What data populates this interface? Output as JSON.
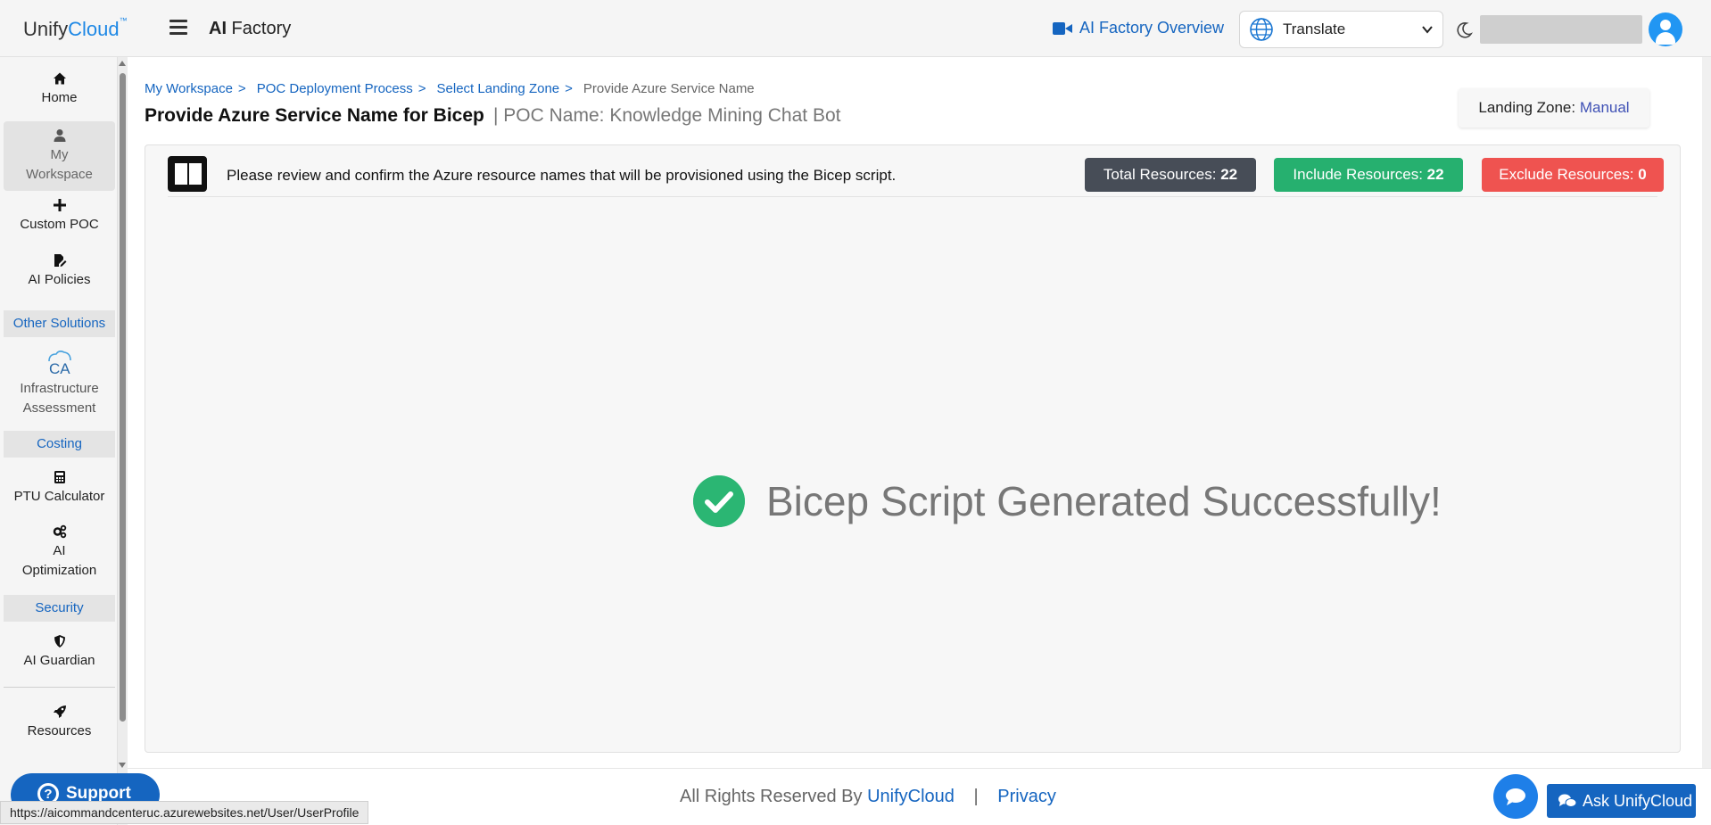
{
  "header": {
    "brand_name": "Unify",
    "brand_cloud": "Cloud",
    "brand_tm": "™",
    "app_title_bold": "AI",
    "app_title_rest": " Factory",
    "overview_link": "AI Factory Overview",
    "translate_label": "Translate"
  },
  "sidebar": {
    "items": [
      {
        "label": "Home",
        "icon": "home-icon"
      },
      {
        "label": "My Workspace",
        "icon": "user-icon"
      },
      {
        "label": "Custom POC",
        "icon": "plus-icon"
      },
      {
        "label": "AI Policies",
        "icon": "edit-document-icon"
      }
    ],
    "section_other": "Other Solutions",
    "infra_label_1": "Infrastructure",
    "infra_label_2": "Assessment",
    "section_costing": "Costing",
    "ptu_label": "PTU Calculator",
    "ai_opt_label_1": "AI",
    "ai_opt_label_2": "Optimization",
    "section_security": "Security",
    "guardian_label": "AI Guardian",
    "resources_label": "Resources",
    "my_label_1": "My",
    "my_label_2": "Workspace"
  },
  "breadcrumb": {
    "items": [
      "My Workspace",
      "POC Deployment Process",
      "Select Landing Zone"
    ],
    "separator": ">",
    "current": "Provide Azure Service Name"
  },
  "page": {
    "title": "Provide Azure Service Name for Bicep",
    "poc_name": "| POC Name: Knowledge Mining Chat Bot",
    "landing_zone_label": "Landing Zone:",
    "landing_zone_value": "Manual"
  },
  "card": {
    "notice": "Please review and confirm the Azure resource names that will be provisioned using the Bicep script.",
    "total_label": "Total Resources:",
    "total_value": "22",
    "include_label": "Include Resources:",
    "include_value": "22",
    "exclude_label": "Exclude Resources:",
    "exclude_value": "0",
    "success_message": "Bicep Script Generated Successfully!"
  },
  "footer": {
    "rights": "All Rights Reserved By",
    "company": "UnifyCloud",
    "pipe": "|",
    "privacy": "Privacy",
    "support": "Support",
    "ask": "Ask UnifyCloud",
    "status_url": "https://aicommandcenteruc.azurewebsites.net/User/UserProfile"
  },
  "colors": {
    "accent": "#1565c0",
    "total_badge": "#474d57",
    "include_badge": "#26b06f",
    "exclude_badge": "#ef5350",
    "success": "#2bb673"
  }
}
